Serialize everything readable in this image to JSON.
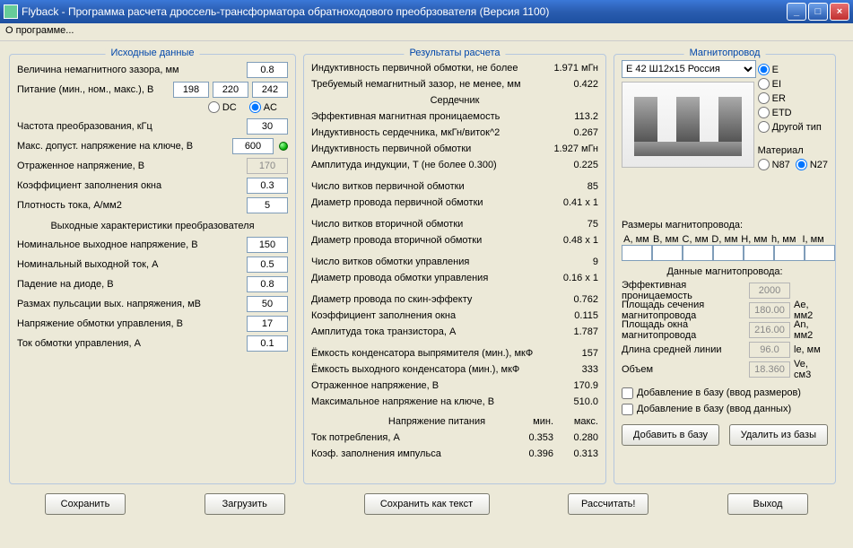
{
  "window": {
    "title": "Flyback - Программа расчета дроссель-трансформатора обратноходового преобрзователя (Версия 1100)"
  },
  "menu": {
    "about": "О программе..."
  },
  "left": {
    "legend": "Исходные данные",
    "gap_label": "Величина немагнитного зазора, мм",
    "gap": "0.8",
    "supply_label": "Питание (мин., ном., макс.), В",
    "supply_min": "198",
    "supply_nom": "220",
    "supply_max": "242",
    "dc": "DC",
    "ac": "AC",
    "freq_label": "Частота преобразования, кГц",
    "freq": "30",
    "vds_label": "Макс. допуст. напряжение на ключе, В",
    "vds": "600",
    "vor_label": "Отраженное напряжение, В",
    "vor": "170",
    "kfill_label": "Коэффициент заполнения окна",
    "kfill": "0.3",
    "j_label": "Плотность тока, А/мм2",
    "j": "5",
    "out_legend": "Выходные характеристики преобразователя",
    "vout_label": "Номинальное выходное напряжение, В",
    "vout": "150",
    "iout_label": "Номинальный выходной ток, А",
    "iout": "0.5",
    "vdiode_label": "Падение на диоде, В",
    "vdiode": "0.8",
    "ripple_label": "Размах пульсации вых. напряжения, мВ",
    "ripple": "50",
    "vaux_label": "Напряжение обмотки управления, В",
    "vaux": "17",
    "iaux_label": "Ток обмотки управления, А",
    "iaux": "0.1"
  },
  "mid": {
    "legend": "Результаты расчета",
    "r1_l": "Индуктивность первичной обмотки, не более",
    "r1_v": "1.971 мГн",
    "r2_l": "Требуемый немагнитный зазор, не менее, мм",
    "r2_v": "0.422",
    "core_head": "Сердечник",
    "r3_l": "Эффективная магнитная проницаемость",
    "r3_v": "113.2",
    "r4_l": "Индуктивность сердечника, мкГн/виток^2",
    "r4_v": "0.267",
    "r5_l": "Индуктивность первичной обмотки",
    "r5_v": "1.927 мГн",
    "r6_l": "Амплитуда индукции, Т       (не более 0.300)",
    "r6_v": "0.225",
    "r7_l": "Число витков первичной обмотки",
    "r7_v": "85",
    "r8_l": "Диаметр провода первичной обмотки",
    "r8_v": "0.41 x 1",
    "r9_l": "Число витков вторичной обмотки",
    "r9_v": "75",
    "r10_l": "Диаметр провода вторичной обмотки",
    "r10_v": "0.48 x 1",
    "r11_l": "Число витков обмотки управления",
    "r11_v": "9",
    "r12_l": "Диаметр провода обмотки управления",
    "r12_v": "0.16 x 1",
    "r13_l": "Диаметр провода по скин-эффекту",
    "r13_v": "0.762",
    "r14_l": "Коэффициент заполнения окна",
    "r14_v": "0.115",
    "r15_l": "Амплитуда тока транзистора, А",
    "r15_v": "1.787",
    "r16_l": "Ёмкость конденсатора выпрямителя (мин.), мкФ",
    "r16_v": "157",
    "r17_l": "Ёмкость выходного конденсатора (мин.), мкФ",
    "r17_v": "333",
    "r18_l": "Отраженное напряжение, В",
    "r18_v": "170.9",
    "r19_l": "Максимальное напряжение на ключе, В",
    "r19_v": "510.0",
    "supply_head": "Напряжение питания",
    "col_min": "мин.",
    "col_max": "макс.",
    "r20_l": "Ток потребления, А",
    "r20_min": "0.353",
    "r20_max": "0.280",
    "r21_l": "Коэф. заполнения импульса",
    "r21_min": "0.396",
    "r21_max": "0.313"
  },
  "right": {
    "legend": "Магнитопровод",
    "core_selected": "E 42 Ш12x15 Россия",
    "opt_e": "E",
    "opt_ei": "EI",
    "opt_er": "ER",
    "opt_etd": "ETD",
    "opt_other": "Другой тип",
    "mat_label": "Материал",
    "mat_n87": "N87",
    "mat_n27": "N27",
    "dims_label": "Размеры магнитопровода:",
    "dim_a": "A, мм",
    "dim_b": "B, мм",
    "dim_c": "C, мм",
    "dim_d": "D, мм",
    "dim_h1": "H, мм",
    "dim_h2": "h, мм",
    "dim_i": "I, мм",
    "data_label": "Данные магнитопровода:",
    "perm_l": "Эффективная проницаемость",
    "perm_v": "2000",
    "ae_l": "Площадь сечения магнитопровода",
    "ae_v": "180.00",
    "ae_u": "Ae, мм2",
    "an_l": "Площадь окна магнитопровода",
    "an_v": "216.00",
    "an_u": "An, мм2",
    "le_l": "Длина средней линии",
    "le_v": "96.0",
    "le_u": "le, мм",
    "ve_l": "Объем",
    "ve_v": "18.360",
    "ve_u": "Ve, см3",
    "chk1": "Добавление в базу (ввод размеров)",
    "chk2": "Добавление в базу (ввод данных)",
    "btn_add": "Добавить в базу",
    "btn_del": "Удалить из базы"
  },
  "buttons": {
    "save": "Сохранить",
    "load": "Загрузить",
    "savetxt": "Сохранить как текст",
    "calc": "Рассчитать!",
    "exit": "Выход"
  }
}
